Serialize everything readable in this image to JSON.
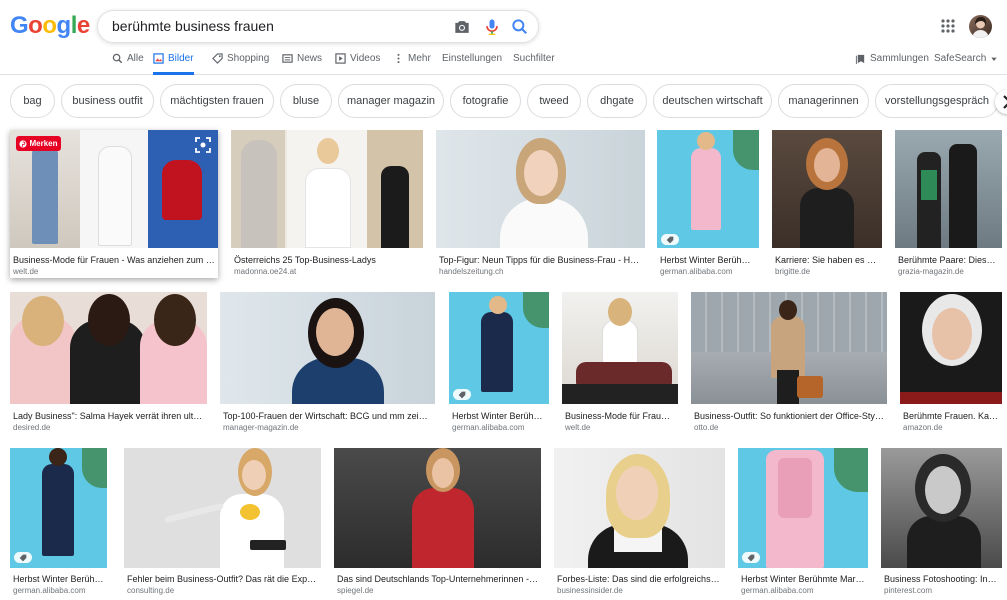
{
  "header": {
    "logo": "Google",
    "search_query": "berühmte business frauen",
    "tabs": [
      {
        "label": "Alle"
      },
      {
        "label": "Bilder"
      },
      {
        "label": "Shopping"
      },
      {
        "label": "News"
      },
      {
        "label": "Videos"
      },
      {
        "label": "Mehr"
      },
      {
        "label": "Einstellungen"
      },
      {
        "label": "Suchfilter"
      }
    ],
    "collections_label": "Sammlungen",
    "safesearch_label": "SafeSearch"
  },
  "chips": [
    "bag",
    "business outfit",
    "mächtigsten frauen",
    "bluse",
    "manager magazin",
    "fotografie",
    "tweed",
    "dhgate",
    "deutschen wirtschaft",
    "managerinnen",
    "vorstellungsgespräch"
  ],
  "pin_label": "Merken",
  "results": [
    {
      "title": "Business-Mode für Frauen - Was anziehen zum Vo...",
      "source": "welt.de"
    },
    {
      "title": "Österreichs 25 Top-Business-Ladys",
      "source": "madonna.oe24.at"
    },
    {
      "title": "Top-Figur: Neun Tipps für die Business-Frau - Han...",
      "source": "handelszeitung.ch"
    },
    {
      "title": "Herbst Winter Berühmt...",
      "source": "german.alibaba.com"
    },
    {
      "title": "Karriere: Sie haben es ge...",
      "source": "brigitte.de"
    },
    {
      "title": "Berühmte Paare: Diese ...",
      "source": "grazia-magazin.de"
    },
    {
      "title": "Lady Business\": Salma Hayek verrät ihren ultim...",
      "source": "desired.de"
    },
    {
      "title": "Top-100-Frauen der Wirtschaft: BCG und mm zeichn...",
      "source": "manager-magazin.de"
    },
    {
      "title": "Herbst Winter Berühmt...",
      "source": "german.alibaba.com"
    },
    {
      "title": "Business-Mode für Frauen...",
      "source": "welt.de"
    },
    {
      "title": "Business-Outfit: So funktioniert der Office-Styl...",
      "source": "otto.de"
    },
    {
      "title": "Berühmte Frauen. Kale...",
      "source": "amazon.de"
    },
    {
      "title": "Herbst Winter Berühmt...",
      "source": "german.alibaba.com"
    },
    {
      "title": "Fehler beim Business-Outfit? Das rät die Experti...",
      "source": "consulting.de"
    },
    {
      "title": "Das sind Deutschlands Top-Unternehmerinnen - D...",
      "source": "spiegel.de"
    },
    {
      "title": "Forbes-Liste: Das sind die erfolgreichste...",
      "source": "businessinsider.de"
    },
    {
      "title": "Herbst Winter Berühmte Mark...",
      "source": "german.alibaba.com"
    },
    {
      "title": "Business Fotoshooting: Ins...",
      "source": "pinterest.com"
    }
  ]
}
